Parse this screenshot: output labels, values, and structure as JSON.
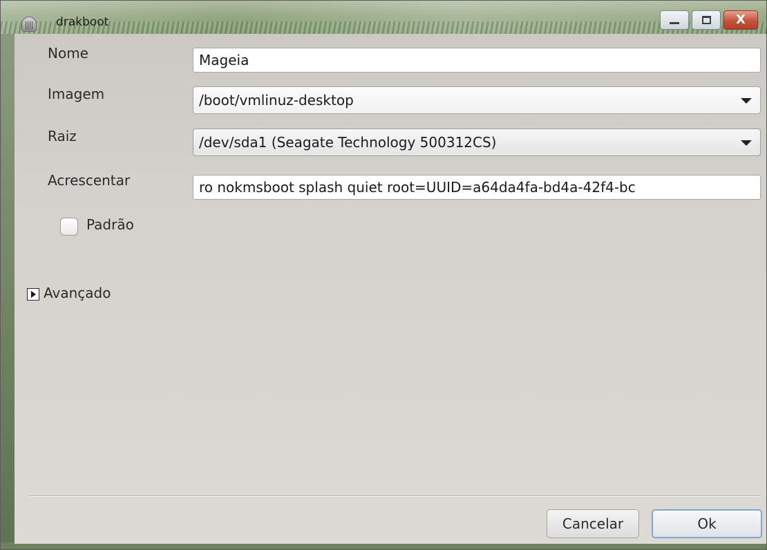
{
  "window": {
    "title": "drakboot",
    "icon": "drakboot-app-icon",
    "controls": {
      "minimize": "minimize-icon",
      "maximize": "maximize-icon",
      "close": "X"
    }
  },
  "form": {
    "name_label": "Nome",
    "name_value": "Mageia",
    "image_label": "Imagem",
    "image_value": "/boot/vmlinuz-desktop",
    "root_label": "Raiz",
    "root_value": "/dev/sda1 (Seagate Technology 500312CS)",
    "append_label": "Acrescentar",
    "append_value": "ro nokmsboot splash quiet root=UUID=a64da4fa-bd4a-42f4-bc",
    "default_label": "Padrão",
    "default_checked": false
  },
  "advanced": {
    "label": "Avançado",
    "expanded": false
  },
  "buttons": {
    "cancel": "Cancelar",
    "ok": "Ok"
  }
}
